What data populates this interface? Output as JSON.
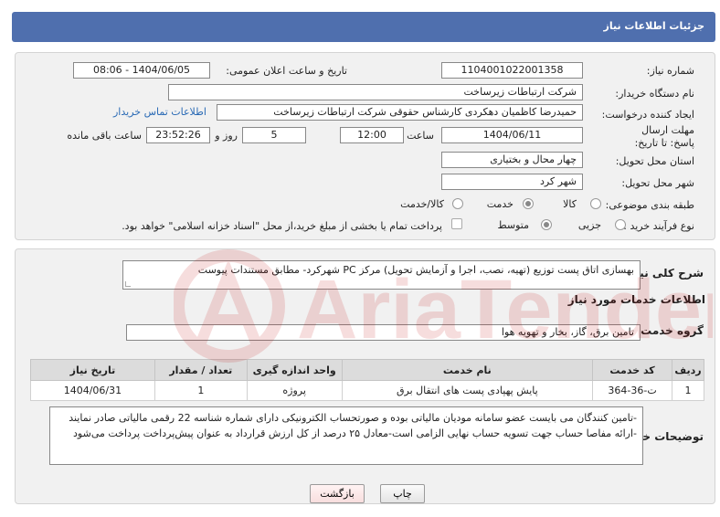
{
  "header": {
    "title": "جزئیات اطلاعات نیاز"
  },
  "info": {
    "need_number_label": "شماره نیاز:",
    "need_number": "1104001022001358",
    "announce_label": "تاریخ و ساعت اعلان عمومی:",
    "announce_value": "1404/06/05 - 08:06",
    "buyer_org_label": "نام دستگاه خریدار:",
    "buyer_org": "شرکت ارتباطات زیرساخت",
    "requester_label": "ایجاد کننده درخواست:",
    "requester": "حمیدرضا کاظمیان دهکردی کارشناس حقوقی شرکت ارتباطات زیرساخت",
    "buyer_contact_link": "اطلاعات تماس خریدار",
    "deadline_label": "مهلت ارسال پاسخ: تا تاریخ:",
    "deadline_date": "1404/06/11",
    "time_label": "ساعت",
    "deadline_time": "12:00",
    "days_value": "5",
    "days_label": "روز و",
    "remaining_time": "23:52:26",
    "remaining_label": "ساعت باقی مانده",
    "province_label": "استان محل تحویل:",
    "province": "چهار محال و بختیاری",
    "city_label": "شهر محل تحویل:",
    "city": "شهر کرد",
    "category_label": "طبقه بندی موضوعی:",
    "category_options": [
      "کالا",
      "خدمت",
      "کالا/خدمت"
    ],
    "category_selected": "خدمت",
    "process_label": "نوع فرآیند خرید :",
    "process_options": [
      "جزیی",
      "متوسط"
    ],
    "process_selected": "متوسط",
    "treasury_note": "پرداخت تمام یا بخشی از مبلغ خرید،از محل \"اسناد خزانه اسلامی\" خواهد بود."
  },
  "summary": {
    "label": "شرح کلی نیاز:",
    "text": "بهسازی اتاق پست توزیع (تهیه، نصب، اجرا و آزمایش تحویل) مرکز PC شهرکرد- مطابق مستندات پیوست"
  },
  "services": {
    "section_title": "اطلاعات خدمات مورد نیاز",
    "group_label": "گروه خدمت:",
    "group_value": "تامین برق، گاز، بخار و تهویه هوا",
    "columns": [
      "ردیف",
      "کد خدمت",
      "نام خدمت",
      "واحد اندازه گیری",
      "تعداد / مقدار",
      "تاریخ نیاز"
    ],
    "rows": [
      [
        "1",
        "ت-36-364",
        "پایش پهپادی پست های انتقال برق",
        "پروژه",
        "1",
        "1404/06/31"
      ]
    ]
  },
  "buyer_notes": {
    "label": "توضیحات خریدار:",
    "text": "-تامین کنندگان می بایست عضو سامانه مودیان مالیاتی بوده و صورتحساب الکترونیکی دارای شماره شناسه 22 رقمی مالیاتی صادر نمایند -ارائه مفاصا حساب جهت تسویه حساب نهایی الزامی است-معادل ۲۵ درصد از کل ارزش قرارداد به عنوان پیش‌پرداخت پرداخت می‌شود"
  },
  "actions": {
    "print_label": "چاپ",
    "back_label": "بازگشت"
  },
  "watermark": {
    "text": "AriaTender.neT"
  },
  "colors": {
    "header": "#4f6fae",
    "panel": "#f1f1f1",
    "link": "#2a6ab5",
    "back_button": "#f8dede"
  }
}
